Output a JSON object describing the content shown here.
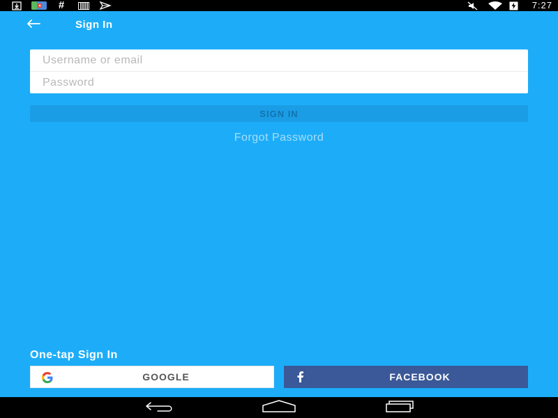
{
  "status_bar": {
    "time": "7:27",
    "left_icons": [
      "download-icon",
      "maps-icon",
      "hash-icon",
      "sd-card-icon",
      "play-store-icon"
    ],
    "right_icons": [
      "mute-icon",
      "wifi-icon",
      "battery-charging-icon"
    ]
  },
  "app_bar": {
    "title": "Sign In",
    "back_icon": "arrow-back-icon"
  },
  "form": {
    "username_placeholder": "Username or email",
    "password_placeholder": "Password",
    "sign_in_label": "SIGN IN",
    "forgot_password_label": "Forgot Password"
  },
  "one_tap": {
    "heading": "One-tap Sign In",
    "google_label": "GOOGLE",
    "facebook_label": "FACEBOOK"
  },
  "nav_bar": {
    "icons": [
      "back-nav-icon",
      "home-nav-icon",
      "recents-nav-icon"
    ]
  },
  "colors": {
    "background": "#1DADF8",
    "sign_in_button": "#1B9DE6",
    "facebook": "#3B5998",
    "forgot_link": "#A9DDF8"
  }
}
